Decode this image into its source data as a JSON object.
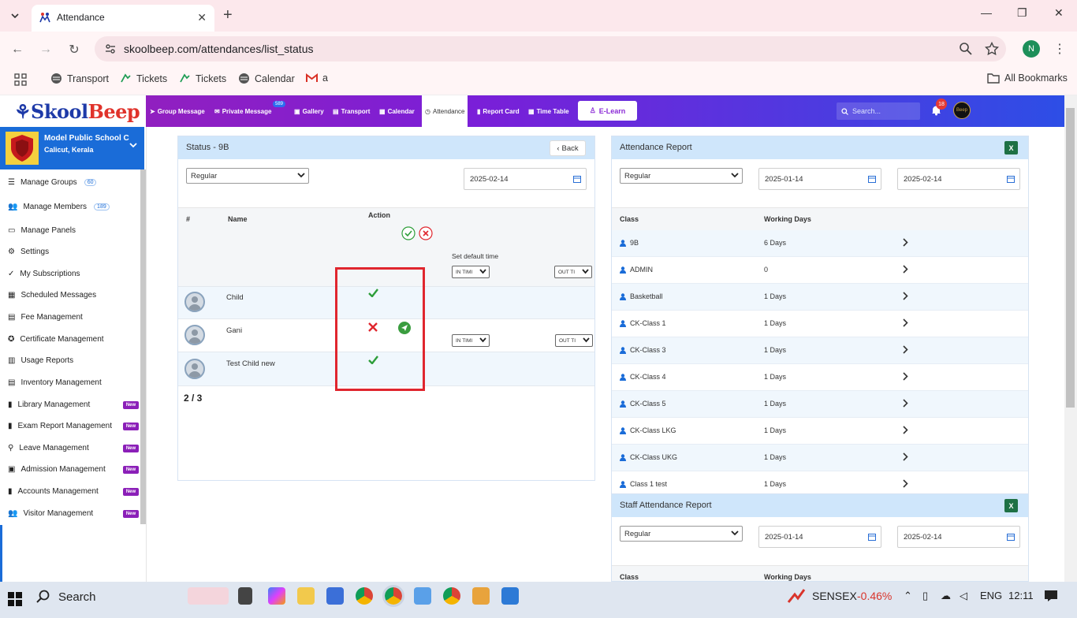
{
  "browser": {
    "tab_title": "Attendance",
    "url": "skoolbeep.com/attendances/list_status",
    "profile_initial": "N",
    "bookmarks": [
      "Transport",
      "Tickets",
      "Tickets",
      "Calendar",
      "a"
    ],
    "all_bookmarks": "All Bookmarks"
  },
  "app": {
    "logo_skool": "Skool",
    "logo_beep": "Beep",
    "nav": [
      "Group Message",
      "Private Message",
      "Gallery",
      "Transport",
      "Calendar",
      "Attendance",
      "Report Card",
      "Time Table"
    ],
    "private_message_badge": "589",
    "elearn": "E-Learn",
    "search_placeholder": "Search...",
    "notification_count": "18",
    "avatar_text": "Beep"
  },
  "sidebar": {
    "school_name": "Model Public School C",
    "school_location": "Calicut, Kerala",
    "new_label": "New",
    "items": [
      {
        "label": "Manage Groups",
        "count": "60"
      },
      {
        "label": "Manage Members",
        "count": "189"
      },
      {
        "label": "Manage Panels"
      },
      {
        "label": "Settings"
      },
      {
        "label": "My Subscriptions"
      },
      {
        "label": "Scheduled Messages"
      },
      {
        "label": "Fee Management"
      },
      {
        "label": "Certificate Management"
      },
      {
        "label": "Usage Reports"
      },
      {
        "label": "Inventory Management"
      },
      {
        "label": "Library Management",
        "new": true
      },
      {
        "label": "Exam Report Management",
        "new": true
      },
      {
        "label": "Leave Management",
        "new": true
      },
      {
        "label": "Admission Management",
        "new": true
      },
      {
        "label": "Accounts Management",
        "new": true
      },
      {
        "label": "Visitor Management",
        "new": true
      }
    ]
  },
  "status_panel": {
    "title": "Status - 9B",
    "back": "Back",
    "type_select": "Regular",
    "date": "2025-02-14",
    "col_hash": "#",
    "col_name": "Name",
    "col_action": "Action",
    "set_default_time": "Set default time",
    "in_time": "IN TIMI",
    "out_time": "OUT TI",
    "students": [
      {
        "name": "Child",
        "status": "present"
      },
      {
        "name": "Gani",
        "status": "absent"
      },
      {
        "name": "Test Child new",
        "status": "present"
      }
    ],
    "count": "2 / 3"
  },
  "attendance_report": {
    "title": "Attendance Report",
    "type_select": "Regular",
    "from_date": "2025-01-14",
    "to_date": "2025-02-14",
    "col_class": "Class",
    "col_days": "Working Days",
    "rows": [
      {
        "class": "9B",
        "days": "6 Days"
      },
      {
        "class": "ADMIN",
        "days": "0"
      },
      {
        "class": "Basketball",
        "days": "1 Days"
      },
      {
        "class": "CK-Class 1",
        "days": "1 Days"
      },
      {
        "class": "CK-Class 3",
        "days": "1 Days"
      },
      {
        "class": "CK-Class 4",
        "days": "1 Days"
      },
      {
        "class": "CK-Class 5",
        "days": "1 Days"
      },
      {
        "class": "CK-Class LKG",
        "days": "1 Days"
      },
      {
        "class": "CK-Class UKG",
        "days": "1 Days"
      },
      {
        "class": "Class 1 test",
        "days": "1 Days"
      }
    ]
  },
  "staff_report": {
    "title": "Staff Attendance Report",
    "type_select": "Regular",
    "from_date": "2025-01-14",
    "to_date": "2025-02-14",
    "col_class": "Class",
    "col_days": "Working Days"
  },
  "taskbar": {
    "search": "Search",
    "ticker_name": "SENSEX",
    "ticker_value": "-0.46%",
    "lang": "ENG",
    "time": "12:11"
  },
  "colors": {
    "accent": "#1a6cd8",
    "header_start": "#9b1fb5",
    "header_end": "#2d4ee6",
    "present": "#2e9e3a",
    "absent": "#e0262e",
    "highlight": "#e0262e"
  }
}
